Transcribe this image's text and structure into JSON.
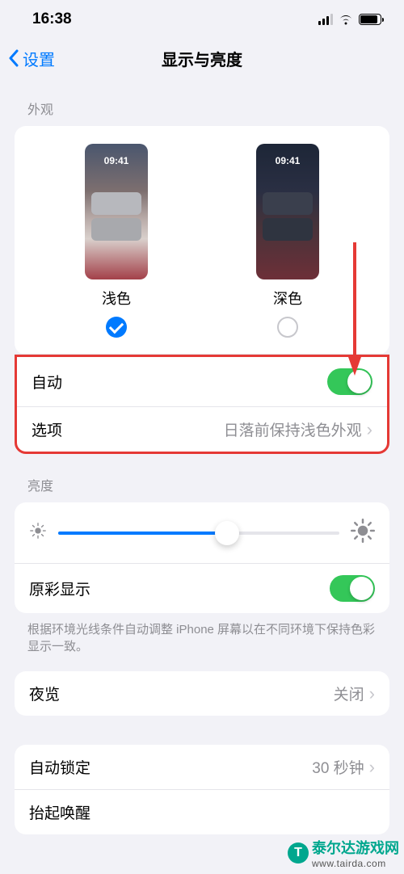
{
  "status": {
    "time": "16:38"
  },
  "nav": {
    "back": "设置",
    "title": "显示与亮度"
  },
  "sections": {
    "appearance": {
      "header": "外观",
      "preview_time": "09:41",
      "light_label": "浅色",
      "dark_label": "深色",
      "selected": "light",
      "auto_label": "自动",
      "auto_on": true,
      "options_label": "选项",
      "options_value": "日落前保持浅色外观"
    },
    "brightness": {
      "header": "亮度",
      "value_pct": 60,
      "truetone_label": "原彩显示",
      "truetone_on": true,
      "footnote": "根据环境光线条件自动调整 iPhone 屏幕以在不同环境下保持色彩显示一致。"
    },
    "nightshift": {
      "label": "夜览",
      "value": "关闭"
    },
    "autolock": {
      "label": "自动锁定",
      "value": "30 秒钟"
    },
    "raise_to_wake": {
      "label": "抬起唤醒"
    }
  },
  "watermark": {
    "site": "泰尔达游戏网",
    "url": "www.tairda.com"
  }
}
